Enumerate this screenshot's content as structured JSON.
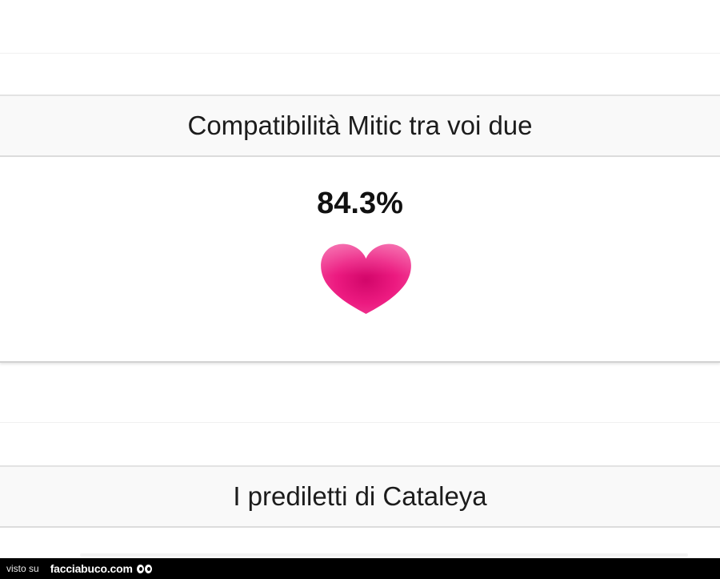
{
  "compatibility": {
    "title": "Compatibilità Mitic tra voi due",
    "percent_label": "84.3%",
    "percent_value": 84.3,
    "heart_color": "#e8157a"
  },
  "favorites": {
    "title": "I prediletti di Cataleya"
  },
  "footer": {
    "prefix": "visto su",
    "brand": "facciabuco.com"
  }
}
